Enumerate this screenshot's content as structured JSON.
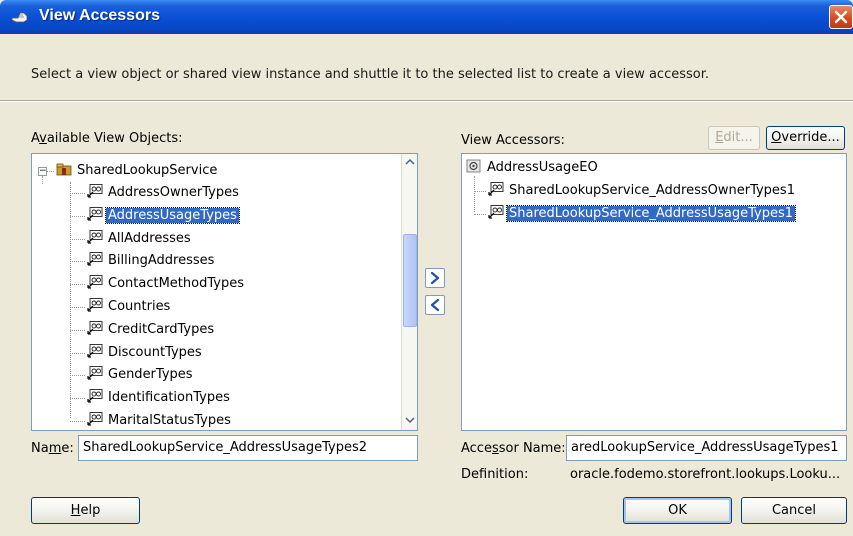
{
  "window": {
    "title": "View Accessors",
    "instruction": "Select a view object or shared view instance and shuttle it to the selected list to create a view accessor."
  },
  "available": {
    "label_pre": "A",
    "label_u": "v",
    "label_post": "ailable View Objects:",
    "root": "SharedLookupService",
    "items": [
      "AddressOwnerTypes",
      "AddressUsageTypes",
      "AllAddresses",
      "BillingAddresses",
      "ContactMethodTypes",
      "Countries",
      "CreditCardTypes",
      "DiscountTypes",
      "GenderTypes",
      "IdentificationTypes",
      "MaritalStatusTypes"
    ],
    "selected_index": 1
  },
  "accessors": {
    "label": "View Accessors:",
    "root": "AddressUsageEO",
    "items": [
      "SharedLookupService_AddressOwnerTypes1",
      "SharedLookupService_AddressUsageTypes1"
    ],
    "selected_index": 1
  },
  "buttons": {
    "edit_pre": "",
    "edit_u": "E",
    "edit_post": "dit...",
    "override_pre": "",
    "override_u": "O",
    "override_post": "verride...",
    "help_pre": "",
    "help_u": "H",
    "help_post": "elp",
    "ok": "OK",
    "cancel": "Cancel"
  },
  "name_field": {
    "label_pre": "Na",
    "label_u": "m",
    "label_post": "e:",
    "value": "SharedLookupService_AddressUsageTypes2"
  },
  "accessor_name": {
    "label_pre": "Acce",
    "label_u": "s",
    "label_post": "sor Name:",
    "value": "aredLookupService_AddressUsageTypes1"
  },
  "definition": {
    "label": "Definition:",
    "value": "oracle.fodemo.storefront.lookups.Looku..."
  },
  "colors": {
    "selection": "#316ac5",
    "titlebar": "#0a50d6",
    "dialog_bg": "#ece9d8"
  },
  "icons": {
    "title": "hand-icon",
    "root_left": "package-icon",
    "root_right": "entity-object-icon",
    "item": "view-object-icon",
    "shuttle_add": "chevron-right-icon",
    "shuttle_remove": "chevron-left-icon"
  }
}
